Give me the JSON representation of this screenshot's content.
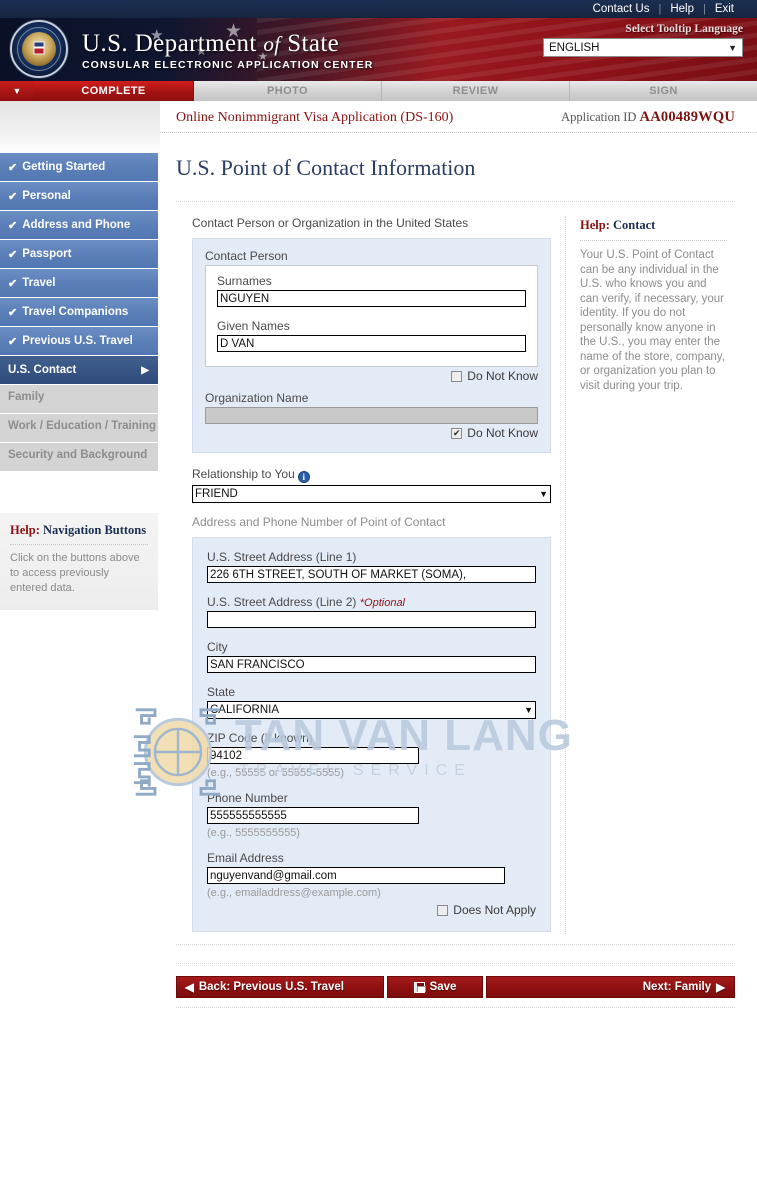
{
  "topbar": {
    "links": [
      "Contact Us",
      "Help",
      "Exit"
    ]
  },
  "banner": {
    "title_us": "U.S.",
    "title_dept": "Department",
    "title_of": "of",
    "title_state": "State",
    "subtitle": "CONSULAR ELECTRONIC APPLICATION CENTER",
    "language_label": "Select Tooltip Language",
    "language_value": "ENGLISH",
    "seal_icon": "department-of-state-seal"
  },
  "steps": [
    {
      "label": "COMPLETE",
      "state": "active"
    },
    {
      "label": "PHOTO",
      "state": "idle"
    },
    {
      "label": "REVIEW",
      "state": "idle"
    },
    {
      "label": "SIGN",
      "state": "idle"
    }
  ],
  "sidebar": {
    "items": [
      {
        "label": "Getting Started",
        "state": "done"
      },
      {
        "label": "Personal",
        "state": "done"
      },
      {
        "label": "Address and Phone",
        "state": "done"
      },
      {
        "label": "Passport",
        "state": "done"
      },
      {
        "label": "Travel",
        "state": "done"
      },
      {
        "label": "Travel Companions",
        "state": "done"
      },
      {
        "label": "Previous U.S. Travel",
        "state": "done"
      },
      {
        "label": "U.S. Contact",
        "state": "current"
      },
      {
        "label": "Family",
        "state": "disabled"
      },
      {
        "label": "Work / Education / Training",
        "state": "disabled"
      },
      {
        "label": "Security and Background",
        "state": "disabled"
      }
    ],
    "help": {
      "title_prefix": "Help:",
      "title": "Navigation Buttons",
      "body": "Click on the buttons above to access previously entered data."
    }
  },
  "appheader": {
    "form_name": "Online Nonimmigrant Visa Application (DS-160)",
    "app_id_label": "Application ID",
    "app_id_value": "AA00489WQU"
  },
  "page_title": "U.S. Point of Contact Information",
  "form": {
    "section1_label": "Contact Person or Organization in the United States",
    "contact_person_label": "Contact Person",
    "surnames_label": "Surnames",
    "surnames_value": "NGUYEN",
    "given_names_label": "Given Names",
    "given_names_value": "D VAN",
    "do_not_know_label": "Do Not Know",
    "surnames_dnk_checked": false,
    "organization_label": "Organization Name",
    "organization_value": "",
    "organization_dnk_checked": true,
    "relationship_label": "Relationship to You",
    "relationship_value": "FRIEND",
    "info_icon": "info-icon",
    "section2_label": "Address and Phone Number of Point of Contact",
    "street1_label": "U.S. Street Address (Line 1)",
    "street1_value": "226 6TH STREET, SOUTH OF MARKET (SOMA),",
    "street2_label": "U.S. Street Address (Line 2)",
    "street2_optional": "*Optional",
    "street2_value": "",
    "city_label": "City",
    "city_value": "SAN FRANCISCO",
    "state_label": "State",
    "state_value": "CALIFORNIA",
    "zip_label": "ZIP Code (if known)",
    "zip_value": "94102",
    "zip_hint": "(e.g., 55555 or 55555-5555)",
    "phone_label": "Phone Number",
    "phone_value": "555555555555",
    "phone_hint": "(e.g., 5555555555)",
    "email_label": "Email Address",
    "email_value": "nguyenvand@gmail.com",
    "email_hint": "(e.g., emailaddress@example.com)",
    "does_not_apply_label": "Does Not Apply",
    "does_not_apply_checked": false
  },
  "help_panel": {
    "title_prefix": "Help:",
    "title": "Contact",
    "body": "Your U.S. Point of Contact can be any individual in the U.S. who knows you and can verify, if necessary, your identity. If you do not personally know anyone in the U.S., you may enter the name of the store, company, or organization you plan to visit during your trip."
  },
  "footer": {
    "back_label": "Back: Previous U.S. Travel",
    "save_label": "Save",
    "next_label": "Next: Family",
    "save_icon": "floppy-disk-icon"
  },
  "watermark": {
    "line1": "TAN VAN LANG",
    "line2": "TRAVEL SERVICE",
    "logo_icon": "tan-van-lang-logo"
  },
  "colors": {
    "brand_red": "#8e1010",
    "nav_blue": "#5b7fb8",
    "nav_current": "#2e4a7a",
    "field_blue": "#e3ebf7",
    "title_navy": "#2a3e63"
  }
}
